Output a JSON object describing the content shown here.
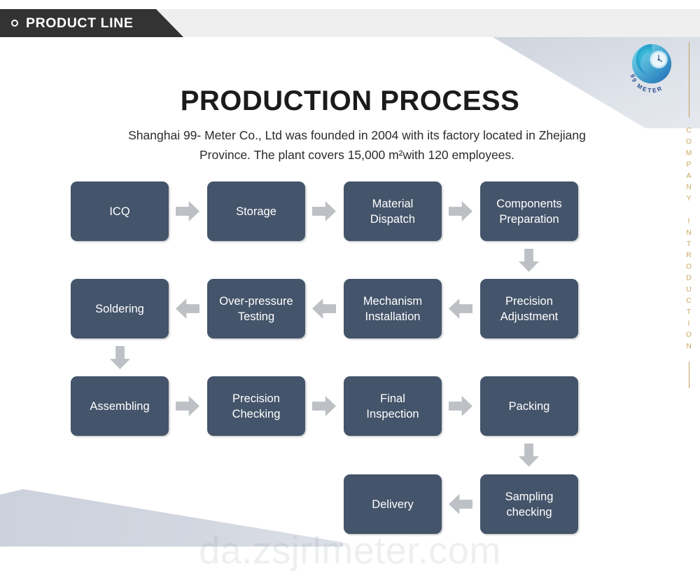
{
  "header": {
    "tab_label": "PRODUCT LINE",
    "bullet_icon": "circle-outline-icon"
  },
  "brand": {
    "logo_icon": "99meter-swirl-logo-icon",
    "logo_text": "99 METER",
    "side_rail_text": "COMPANY INTRODUCTION",
    "side_rail_color": "#c9a961"
  },
  "page": {
    "title": "PRODUCTION PROCESS",
    "description": "Shanghai 99- Meter Co., Ltd was founded in 2004 with its factory located in Zhejiang Province. The plant covers 15,000 m²with 120 employees."
  },
  "colors": {
    "node_fill": "#44546a",
    "arrow_fill": "#bdc0c4",
    "header_bar": "#333333",
    "header_strip": "#efefef",
    "wedge": "#d3d7e0"
  },
  "flow": {
    "nodes": [
      {
        "id": "icq",
        "label": "ICQ"
      },
      {
        "id": "storage",
        "label": "Storage"
      },
      {
        "id": "material-dispatch",
        "label": "Material\nDispatch"
      },
      {
        "id": "components-preparation",
        "label": "Components\nPreparation"
      },
      {
        "id": "precision-adjustment",
        "label": "Precision\nAdjustment"
      },
      {
        "id": "mechanism-installation",
        "label": "Mechanism\nInstallation"
      },
      {
        "id": "over-pressure-testing",
        "label": "Over-pressure\nTesting"
      },
      {
        "id": "soldering",
        "label": "Soldering"
      },
      {
        "id": "assembling",
        "label": "Assembling"
      },
      {
        "id": "precision-checking",
        "label": "Precision\nChecking"
      },
      {
        "id": "final-inspection",
        "label": "Final\nInspection"
      },
      {
        "id": "packing",
        "label": "Packing"
      },
      {
        "id": "sampling-checking",
        "label": "Sampling\nchecking"
      },
      {
        "id": "delivery",
        "label": "Delivery"
      }
    ],
    "connectors": [
      {
        "from": "icq",
        "to": "storage",
        "direction": "right"
      },
      {
        "from": "storage",
        "to": "material-dispatch",
        "direction": "right"
      },
      {
        "from": "material-dispatch",
        "to": "components-preparation",
        "direction": "right"
      },
      {
        "from": "components-preparation",
        "to": "precision-adjustment",
        "direction": "down"
      },
      {
        "from": "precision-adjustment",
        "to": "mechanism-installation",
        "direction": "left"
      },
      {
        "from": "mechanism-installation",
        "to": "over-pressure-testing",
        "direction": "left"
      },
      {
        "from": "over-pressure-testing",
        "to": "soldering",
        "direction": "left"
      },
      {
        "from": "soldering",
        "to": "assembling",
        "direction": "down"
      },
      {
        "from": "assembling",
        "to": "precision-checking",
        "direction": "right"
      },
      {
        "from": "precision-checking",
        "to": "final-inspection",
        "direction": "right"
      },
      {
        "from": "final-inspection",
        "to": "packing",
        "direction": "right"
      },
      {
        "from": "packing",
        "to": "sampling-checking",
        "direction": "down"
      },
      {
        "from": "sampling-checking",
        "to": "delivery",
        "direction": "left"
      }
    ]
  },
  "watermark": {
    "text": "da.zsjrlmeter.com"
  }
}
